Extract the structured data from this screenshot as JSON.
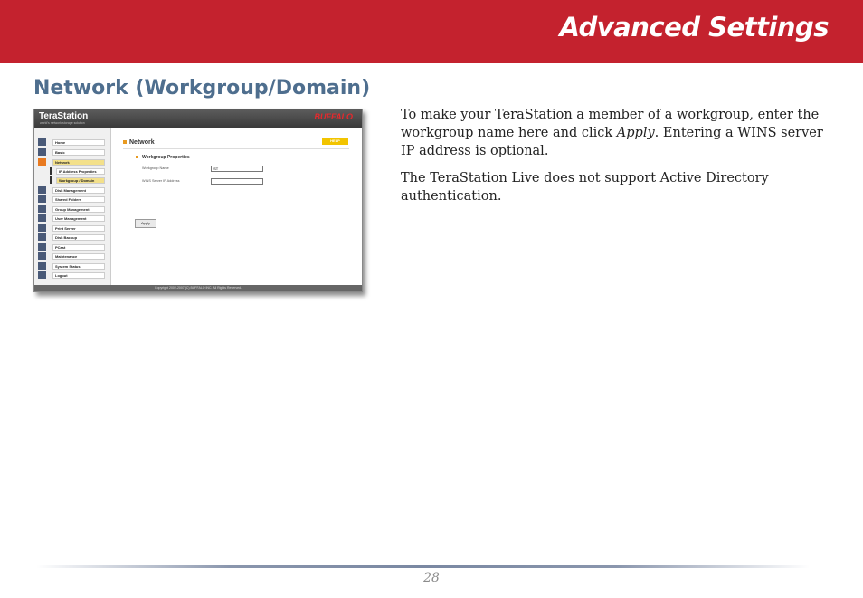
{
  "header": {
    "title": "Advanced Settings"
  },
  "section": {
    "heading": "Network (Workgroup/Domain)"
  },
  "body": {
    "p1_pre": "To make your TeraStation a member of a workgroup, enter the workgroup name here and click ",
    "p1_em": "Apply",
    "p1_post": ".  Entering a WINS server IP address is optional.",
    "p2": "The TeraStation Live does not support Active Directory authentication."
  },
  "screenshot": {
    "logo": "TeraStation",
    "tagline": "world's network storage solution",
    "brand": "BUFFALO",
    "nav": [
      {
        "label": "Home"
      },
      {
        "label": "Basic"
      },
      {
        "label": "Network"
      },
      {
        "label": "IP Address Properties"
      },
      {
        "label": "Workgroup / Domain"
      },
      {
        "label": "Disk Management"
      },
      {
        "label": "Shared Folders"
      },
      {
        "label": "Group Management"
      },
      {
        "label": "User Management"
      },
      {
        "label": "Print Server"
      },
      {
        "label": "Disk Backup"
      },
      {
        "label": "PCast"
      },
      {
        "label": "Maintenance"
      },
      {
        "label": "System Status"
      },
      {
        "label": "Logout"
      }
    ],
    "main_title": "Network",
    "help": "HELP",
    "subsection": "Workgroup Properties",
    "workgroup_label": "Workgroup Name",
    "workgroup_value": "IST",
    "wins_label": "WINS Server IP Address",
    "wins_value": "",
    "apply_label": "Apply",
    "footer": "Copyright 2002-2007 (C) BUFFALO INC. All Rights Reserved."
  },
  "footer": {
    "page_number": "28"
  }
}
